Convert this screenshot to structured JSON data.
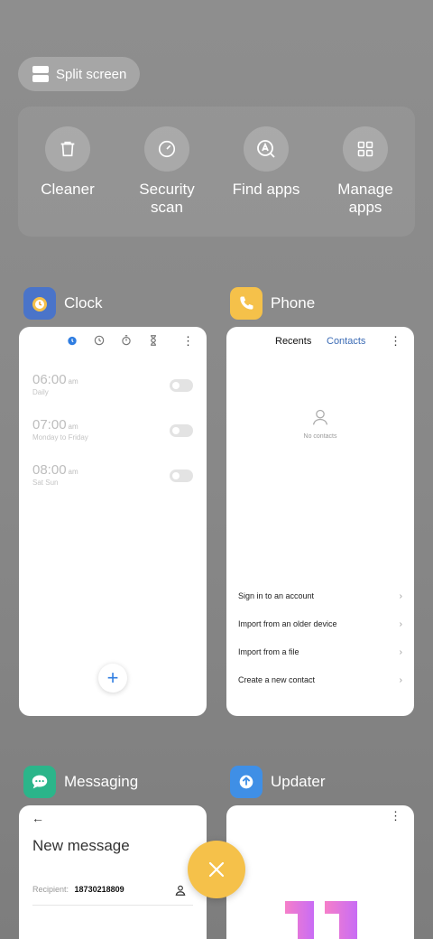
{
  "split_screen": {
    "label": "Split screen"
  },
  "tools": [
    {
      "label": "Cleaner",
      "icon": "trash-icon"
    },
    {
      "label": "Security\nscan",
      "icon": "security-scan-icon"
    },
    {
      "label": "Find apps",
      "icon": "find-apps-icon"
    },
    {
      "label": "Manage\napps",
      "icon": "grid-icon"
    }
  ],
  "clock": {
    "name": "Clock",
    "alarms": [
      {
        "time": "06:00",
        "ampm": "am",
        "repeat": "Daily"
      },
      {
        "time": "07:00",
        "ampm": "am",
        "repeat": "Monday to Friday"
      },
      {
        "time": "08:00",
        "ampm": "am",
        "repeat": "Sat Sun"
      }
    ]
  },
  "phone": {
    "name": "Phone",
    "tabs": {
      "recents": "Recents",
      "contacts": "Contacts"
    },
    "empty_text": "No contacts",
    "options": [
      "Sign in to an account",
      "Import from an older device",
      "Import from a file",
      "Create a new contact"
    ]
  },
  "messaging": {
    "name": "Messaging",
    "title": "New message",
    "recipient_label": "Recipient:",
    "recipient_value": "18730218809"
  },
  "updater": {
    "name": "Updater"
  },
  "colors": {
    "clock_icon": "#4a74c9",
    "phone_icon": "#f5c14a",
    "messaging_icon": "#2bb58a",
    "updater_icon": "#3f8fe6",
    "close_button": "#f5c14a",
    "accent": "#2f7de1"
  }
}
